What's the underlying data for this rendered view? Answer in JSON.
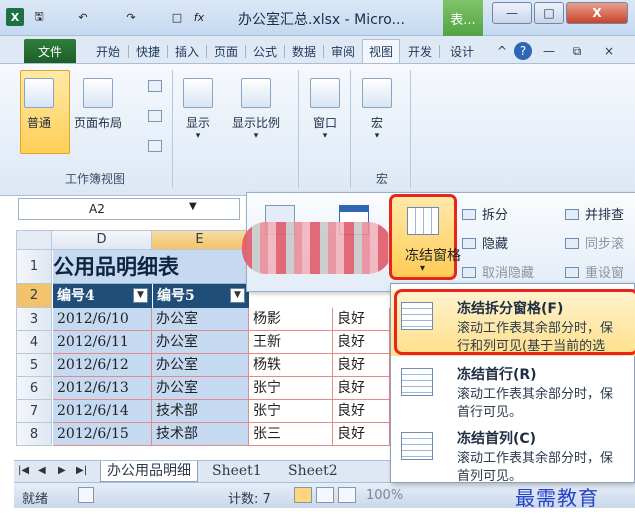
{
  "window": {
    "app_icon": "X",
    "title": "办公室汇总.xlsx - Micro...",
    "context_tab": "表...",
    "fx_glyph": "fx",
    "qat_glyphs": [
      "🖫",
      "↶",
      "↷",
      "□"
    ],
    "min_glyph": "—",
    "max_glyph": "□",
    "close_glyph": "X"
  },
  "tabs": [
    "文件",
    "开始",
    "快捷",
    "插入",
    "页面",
    "公式",
    "数据",
    "审阅",
    "视图",
    "开发",
    "设计"
  ],
  "active_tab_index": 8,
  "tab_right_glyphs": [
    "^",
    "?",
    "—",
    "⧉",
    "×"
  ],
  "ribbon": {
    "workbook_views": {
      "label": "工作簿视图",
      "buttons": [
        "普通",
        "页面布局"
      ]
    },
    "show": "显示",
    "zoom": "显示比例",
    "window": "窗口",
    "macro": "宏",
    "macro_group": "宏",
    "dropdown_glyph": "▾"
  },
  "name_box": {
    "value": "A2",
    "arrow": "▼"
  },
  "grid": {
    "columns": [
      "D",
      "E"
    ],
    "rows": [
      "1",
      "2",
      "3",
      "4",
      "5",
      "6",
      "7",
      "8"
    ],
    "title": "公用品明细表",
    "header": [
      "编号4",
      "编号5"
    ],
    "filter_glyph": "▼",
    "data": [
      [
        "2012/6/10",
        "办公室",
        "杨影",
        "良好"
      ],
      [
        "2012/6/11",
        "办公室",
        "王新",
        "良好"
      ],
      [
        "2012/6/12",
        "办公室",
        "杨轶",
        "良好"
      ],
      [
        "2012/6/13",
        "办公室",
        "张宁",
        "良好"
      ],
      [
        "2012/6/14",
        "技术部",
        "张宁",
        "良好"
      ],
      [
        "2012/6/15",
        "技术部",
        "张三",
        "良好"
      ]
    ]
  },
  "sheets": [
    "办公用品明细",
    "Sheet1",
    "Sheet2"
  ],
  "sheet_nav": [
    "|◀",
    "◀",
    "▶",
    "▶|"
  ],
  "status": {
    "ready": "就绪",
    "count": "计数: 7",
    "zoom": "100%"
  },
  "window_group": {
    "freeze_label": "冻结窗格",
    "split": "拆分",
    "hide": "隐藏",
    "unhide": "取消隐藏",
    "side_by_side": "并排查",
    "sync_scroll": "同步滚",
    "reset_pos": "重设窗"
  },
  "freeze_menu": [
    {
      "title": "冻结拆分窗格(F)",
      "desc": "滚动工作表其余部分时，保\n行和列可见(基于当前的选"
    },
    {
      "title": "冻结首行(R)",
      "desc": "滚动工作表其余部分时，保\n首行可见。"
    },
    {
      "title": "冻结首列(C)",
      "desc": "滚动工作表其余部分时，保\n首列可见。"
    }
  ],
  "watermark": "最需教育"
}
